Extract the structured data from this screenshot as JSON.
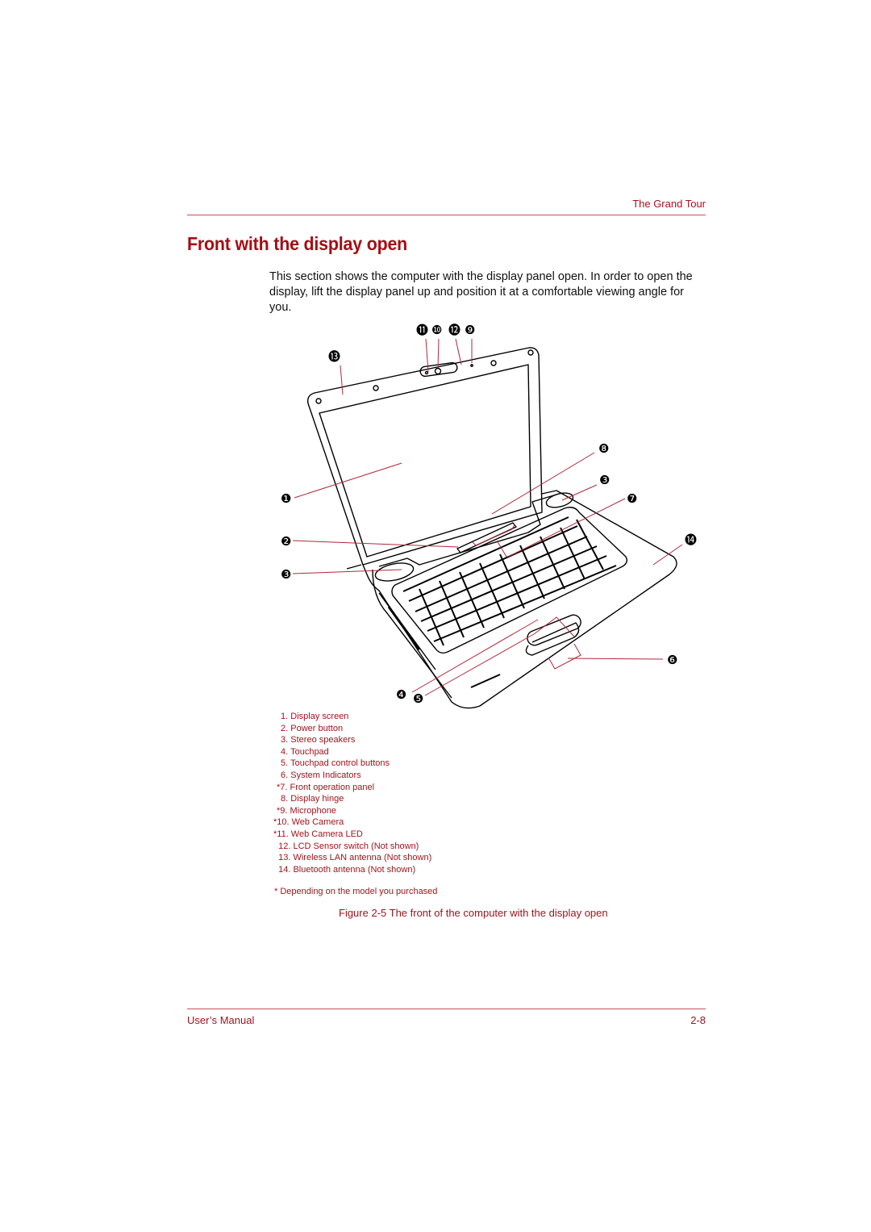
{
  "header": {
    "chapter_title": "The Grand Tour"
  },
  "section": {
    "title": "Front with the display open",
    "intro": "This section shows the computer with the display panel open. In order to open the display, lift the display panel up and position it at a comfortable viewing angle for you."
  },
  "figure": {
    "callouts": {
      "c1": "❶",
      "c2": "❷",
      "c3a": "❸",
      "c3b": "❸",
      "c4": "❹",
      "c5": "❺",
      "c6": "❻",
      "c7": "❼",
      "c8": "❽",
      "c9": "❾",
      "c10": "❿",
      "c11": "⓫",
      "c12": "⓬",
      "c13": "⓭",
      "c14": "⓮"
    },
    "legend": [
      " 1. Display screen",
      " 2. Power button",
      " 3. Stereo speakers",
      " 4. Touchpad",
      " 5. Touchpad control buttons",
      " 6. System Indicators",
      "*7. Front operation panel",
      " 8. Display hinge",
      "*9. Microphone",
      "*10. Web Camera",
      "*11. Web Camera LED",
      "  12. LCD Sensor switch (Not shown)",
      "  13. Wireless LAN antenna (Not shown)",
      "  14. Bluetooth antenna (Not shown)"
    ],
    "footnote": "* Depending on the model you purchased",
    "caption": "Figure 2-5 The front of the computer with the display open"
  },
  "footer": {
    "left": "User’s Manual",
    "page": "2-8"
  },
  "colors": {
    "accent": "#a0141e",
    "leader": "#b0283a"
  }
}
